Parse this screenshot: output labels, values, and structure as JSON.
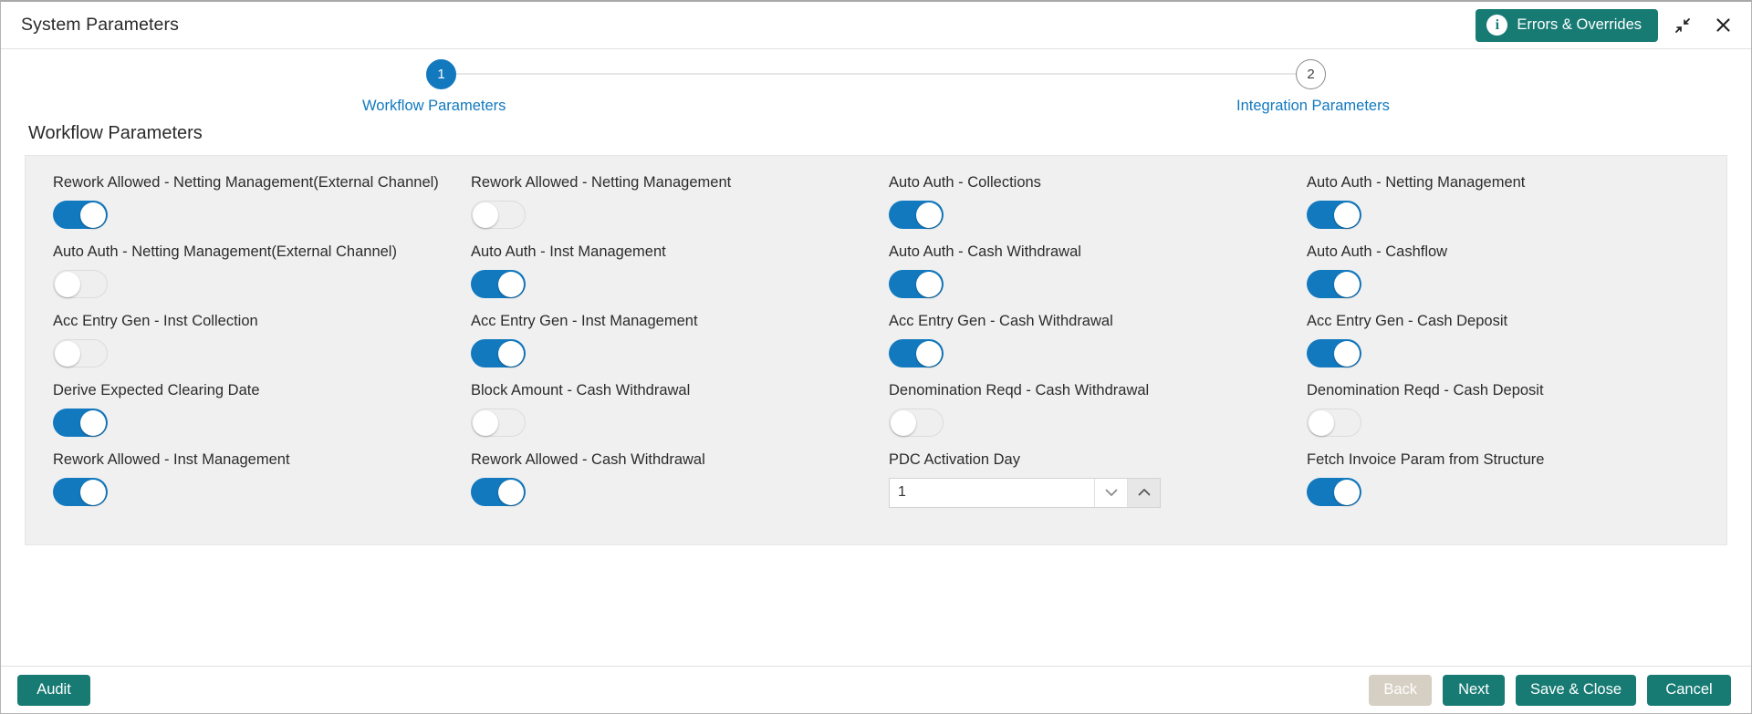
{
  "window": {
    "title": "System Parameters",
    "errors_button_label": "Errors & Overrides",
    "info_icon_glyph": "i",
    "minimize_icon_name": "collapse-icon",
    "close_icon_name": "close-icon"
  },
  "stepper": {
    "steps": [
      {
        "number": "1",
        "label": "Workflow Parameters",
        "state": "active"
      },
      {
        "number": "2",
        "label": "Integration Parameters",
        "state": "inactive"
      }
    ]
  },
  "section": {
    "heading": "Workflow Parameters"
  },
  "fields": [
    {
      "label": "Rework Allowed - Netting Management(External Channel)",
      "type": "toggle",
      "value": "on"
    },
    {
      "label": "Rework Allowed - Netting Management",
      "type": "toggle",
      "value": "off"
    },
    {
      "label": "Auto Auth - Collections",
      "type": "toggle",
      "value": "on"
    },
    {
      "label": "Auto Auth - Netting Management",
      "type": "toggle",
      "value": "on"
    },
    {
      "label": "Auto Auth - Netting Management(External Channel)",
      "type": "toggle",
      "value": "off"
    },
    {
      "label": "Auto Auth - Inst Management",
      "type": "toggle",
      "value": "on"
    },
    {
      "label": "Auto Auth - Cash Withdrawal",
      "type": "toggle",
      "value": "on"
    },
    {
      "label": "Auto Auth - Cashflow",
      "type": "toggle",
      "value": "on"
    },
    {
      "label": "Acc Entry Gen - Inst Collection",
      "type": "toggle",
      "value": "off"
    },
    {
      "label": "Acc Entry Gen - Inst Management",
      "type": "toggle",
      "value": "on"
    },
    {
      "label": "Acc Entry Gen - Cash Withdrawal",
      "type": "toggle",
      "value": "on"
    },
    {
      "label": "Acc Entry Gen - Cash Deposit",
      "type": "toggle",
      "value": "on"
    },
    {
      "label": "Derive Expected Clearing Date",
      "type": "toggle",
      "value": "on"
    },
    {
      "label": "Block Amount - Cash Withdrawal",
      "type": "toggle",
      "value": "off"
    },
    {
      "label": "Denomination Reqd - Cash Withdrawal",
      "type": "toggle",
      "value": "off"
    },
    {
      "label": "Denomination Reqd - Cash Deposit",
      "type": "toggle",
      "value": "off"
    },
    {
      "label": "Rework Allowed - Inst Management",
      "type": "toggle",
      "value": "on"
    },
    {
      "label": "Rework Allowed - Cash Withdrawal",
      "type": "toggle",
      "value": "on"
    },
    {
      "label": "PDC Activation Day",
      "type": "number",
      "value": "1",
      "placeholder": ""
    },
    {
      "label": "Fetch Invoice Param from Structure",
      "type": "toggle",
      "value": "on"
    }
  ],
  "footer": {
    "audit_label": "Audit",
    "back_label": "Back",
    "back_state": "disabled",
    "next_label": "Next",
    "save_close_label": "Save & Close",
    "cancel_label": "Cancel"
  },
  "colors": {
    "teal": "#177b74",
    "blue": "#1279bf",
    "panel_bg": "#f0f0f0",
    "disabled_btn": "#d6cfc3",
    "toggle_off": "#efefef"
  }
}
